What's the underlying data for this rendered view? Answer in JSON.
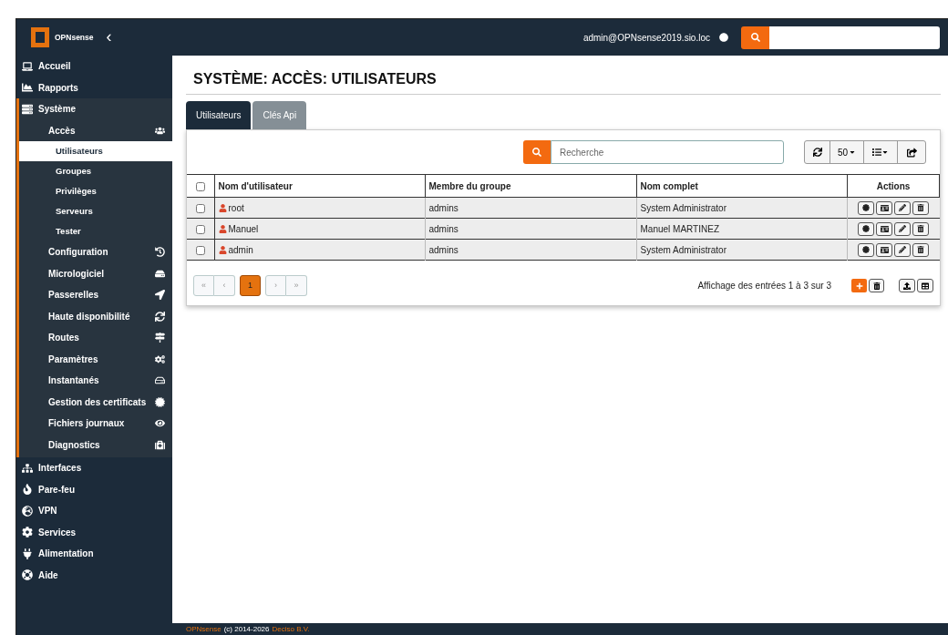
{
  "header": {
    "brand": "OPNsense",
    "collapse": "‹",
    "user": "admin@OPNsense2019.sio.loc"
  },
  "sidebar": {
    "items": [
      {
        "label": "Accueil",
        "selected": false
      },
      {
        "label": "Rapports",
        "selected": false
      },
      {
        "label": "Système",
        "selected": false,
        "expanded": true,
        "children": [
          {
            "label": "Accès",
            "selected": false,
            "expanded": true,
            "children": [
              {
                "label": "Utilisateurs",
                "selected": true
              },
              {
                "label": "Groupes",
                "selected": false
              },
              {
                "label": "Privilèges",
                "selected": false
              },
              {
                "label": "Serveurs",
                "selected": false
              },
              {
                "label": "Tester",
                "selected": false
              }
            ]
          },
          {
            "label": "Configuration",
            "selected": false
          },
          {
            "label": "Micrologiciel",
            "selected": false
          },
          {
            "label": "Passerelles",
            "selected": false
          },
          {
            "label": "Haute disponibilité",
            "selected": false
          },
          {
            "label": "Routes",
            "selected": false
          },
          {
            "label": "Paramètres",
            "selected": false
          },
          {
            "label": "Instantanés",
            "selected": false
          },
          {
            "label": "Gestion des certificats",
            "selected": false
          },
          {
            "label": "Fichiers journaux",
            "selected": false
          },
          {
            "label": "Diagnostics",
            "selected": false
          }
        ]
      },
      {
        "label": "Interfaces",
        "selected": false
      },
      {
        "label": "Pare-feu",
        "selected": false
      },
      {
        "label": "VPN",
        "selected": false
      },
      {
        "label": "Services",
        "selected": false
      },
      {
        "label": "Alimentation",
        "selected": false
      },
      {
        "label": "Aide",
        "selected": false
      }
    ]
  },
  "page_title": "SYSTÈME: ACCÈS: UTILISATEURS",
  "tabs": [
    {
      "label": "Utilisateurs",
      "selected": true
    },
    {
      "label": "Clés Api",
      "selected": false
    }
  ],
  "toolbar": {
    "search": {
      "placeholder": "Recherche"
    },
    "page_size": "50"
  },
  "table": {
    "select_all": {
      "checked": false
    },
    "columns": [
      "Nom d'utilisateur",
      "Membre du groupe",
      "Nom complet",
      "Actions"
    ],
    "rows": [
      {
        "checked": false,
        "cells": [
          "root",
          "admins",
          "System Administrator"
        ]
      },
      {
        "checked": false,
        "cells": [
          "Manuel",
          "admins",
          "Manuel MARTINEZ"
        ]
      },
      {
        "checked": false,
        "cells": [
          "admin",
          "admins",
          "System Administrator"
        ]
      }
    ]
  },
  "pagination": {
    "pages": [
      {
        "label": "«",
        "selected": false,
        "disabled": true
      },
      {
        "label": "‹",
        "selected": false,
        "disabled": true
      },
      {
        "label": "1",
        "selected": true,
        "disabled": false
      },
      {
        "label": "›",
        "selected": false,
        "disabled": true
      },
      {
        "label": "»",
        "selected": false,
        "disabled": true
      }
    ],
    "info": "Affichage des entrées 1 à 3 sur 3"
  },
  "footer": {
    "brand": "OPNsense",
    "copyright": "(c) 2014-2026",
    "company": "Deciso B.V."
  }
}
